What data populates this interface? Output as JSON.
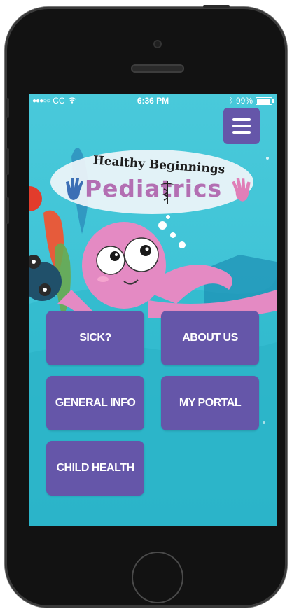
{
  "status_bar": {
    "carrier": "CC",
    "time": "6:36 PM",
    "battery_percent": "99%",
    "battery_level": 0.99
  },
  "header": {
    "menu_icon": "hamburger-menu-icon"
  },
  "logo": {
    "line1": "Healthy Beginnings",
    "line2": "Pediatrics"
  },
  "tiles": [
    {
      "label": "SICK?"
    },
    {
      "label": "ABOUT US"
    },
    {
      "label": "GENERAL INFO"
    },
    {
      "label": "MY PORTAL"
    },
    {
      "label": "CHILD HEALTH"
    }
  ],
  "colors": {
    "tile_bg": "#6556a9",
    "water": "#3ec6d8",
    "octopus": "#e48ac3",
    "logo_text": "#b36fb3"
  }
}
